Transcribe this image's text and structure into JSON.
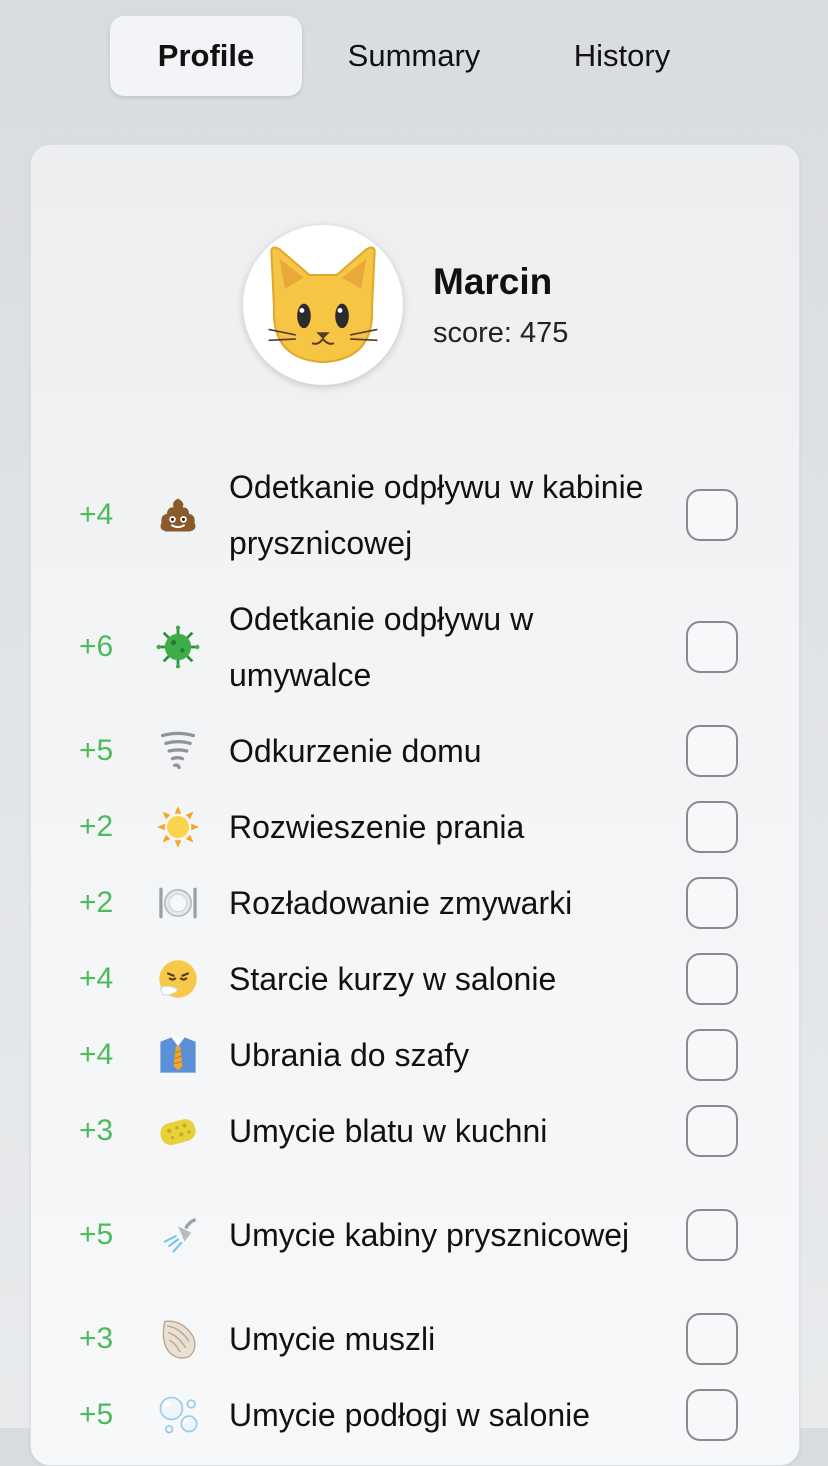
{
  "tabs": [
    {
      "label": "Profile",
      "active": true
    },
    {
      "label": "Summary",
      "active": false
    },
    {
      "label": "History",
      "active": false
    }
  ],
  "profile": {
    "avatar_icon": "cat-face-icon",
    "name": "Marcin",
    "score_label": "score:",
    "score_value": "475"
  },
  "colors": {
    "points": "#4cbb5c",
    "checkbox_border": "#8a8a8e"
  },
  "tasks": [
    {
      "points": "+4",
      "icon": "poop-icon",
      "label": "Odetkanie odpływu w kabinie prysznicowej",
      "checked": false
    },
    {
      "points": "+6",
      "icon": "microbe-icon",
      "label": "Odetkanie odpływu w umywalce",
      "checked": false
    },
    {
      "points": "+5",
      "icon": "tornado-icon",
      "label": "Odkurzenie domu",
      "checked": false
    },
    {
      "points": "+2",
      "icon": "sun-icon",
      "label": "Rozwieszenie prania",
      "checked": false
    },
    {
      "points": "+2",
      "icon": "plate-cutlery-icon",
      "label": "Rozładowanie zmywarki",
      "checked": false
    },
    {
      "points": "+4",
      "icon": "sneezing-face-icon",
      "label": "Starcie kurzy w salonie",
      "checked": false
    },
    {
      "points": "+4",
      "icon": "shirt-tie-icon",
      "label": "Ubrania do szafy",
      "checked": false
    },
    {
      "points": "+3",
      "icon": "sponge-icon",
      "label": "Umycie blatu w kuchni",
      "checked": false
    },
    {
      "points": "+5",
      "icon": "shower-icon",
      "label": "Umycie kabiny prysznicowej",
      "checked": false
    },
    {
      "points": "+3",
      "icon": "shell-icon",
      "label": "Umycie muszli",
      "checked": false
    },
    {
      "points": "+5",
      "icon": "bubbles-icon",
      "label": "Umycie podłogi w salonie",
      "checked": false
    }
  ]
}
